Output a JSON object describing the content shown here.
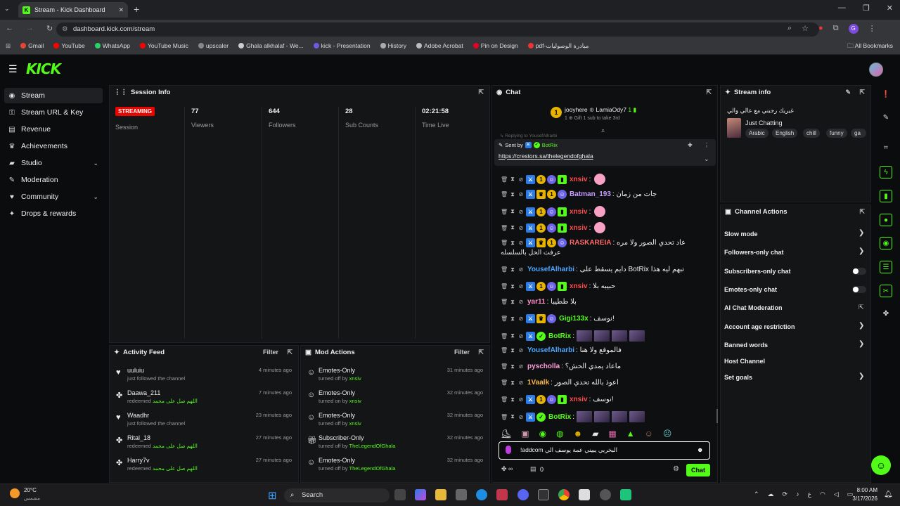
{
  "browser": {
    "tab_title": "Stream - Kick Dashboard",
    "url": "dashboard.kick.com/stream",
    "bookmarks": [
      "Gmail",
      "YouTube",
      "WhatsApp",
      "YouTube Music",
      "upscaler",
      "Ghala alkhalaf - We...",
      "kick - Presentation",
      "History",
      "Adobe Acrobat",
      "Pin on Design",
      "pdf-مبادرة الوصوليات"
    ],
    "all_bookmarks": "All Bookmarks",
    "profile_letter": "G"
  },
  "app": {
    "logo": "KICK"
  },
  "sidebar": {
    "items": [
      {
        "label": "Stream",
        "icon": "stream-icon"
      },
      {
        "label": "Stream URL & Key",
        "icon": "key-icon"
      },
      {
        "label": "Revenue",
        "icon": "revenue-icon"
      },
      {
        "label": "Achievements",
        "icon": "trophy-icon"
      },
      {
        "label": "Studio",
        "icon": "studio-icon"
      },
      {
        "label": "Moderation",
        "icon": "wrench-icon"
      },
      {
        "label": "Community",
        "icon": "community-icon"
      },
      {
        "label": "Drops & rewards",
        "icon": "gift-icon"
      }
    ]
  },
  "session": {
    "title": "Session Info",
    "badge": "STREAMING",
    "session_label": "Session",
    "viewers": "77",
    "viewers_label": "Viewers",
    "followers": "644",
    "followers_label": "Followers",
    "subs": "28",
    "subs_label": "Sub Counts",
    "time": "02:21:58",
    "time_label": "Time Live"
  },
  "activity": {
    "title": "Activity Feed",
    "filter": "Filter",
    "rows": [
      {
        "name": "uuluiu",
        "sub": "just followed the channel",
        "extra": "",
        "time": "4 minutes ago"
      },
      {
        "name": "Daawa_211",
        "sub": "redeemed",
        "extra": "اللهم صل على محمد",
        "time": "7 minutes ago"
      },
      {
        "name": "Waadhr",
        "sub": "just followed the channel",
        "extra": "",
        "time": "23 minutes ago"
      },
      {
        "name": "Rital_18",
        "sub": "redeemed",
        "extra": "اللهم صل على محمد",
        "time": "27 minutes ago"
      },
      {
        "name": "Harry7v",
        "sub": "redeemed",
        "extra": "اللهم صل على محمد",
        "time": "27 minutes ago"
      }
    ]
  },
  "mod_actions": {
    "title": "Mod Actions",
    "filter": "Filter",
    "rows": [
      {
        "name": "Emotes-Only",
        "sub": "turned off by",
        "by": "xnsiv",
        "time": "31 minutes ago"
      },
      {
        "name": "Emotes-Only",
        "sub": "turned on by",
        "by": "xnsiv",
        "time": "32 minutes ago"
      },
      {
        "name": "Emotes-Only",
        "sub": "turned off by",
        "by": "xnsiv",
        "time": "32 minutes ago"
      },
      {
        "name": "Subscriber-Only",
        "sub": "turned off by",
        "by": "TheLegendOfGhala",
        "time": "32 minutes ago"
      },
      {
        "name": "Emotes-Only",
        "sub": "turned off by",
        "by": "TheLegendOfGhala",
        "time": "32 minutes ago"
      }
    ]
  },
  "chat": {
    "title": "Chat",
    "gift_from": "jooyhere",
    "gift_to": "LamiaOdy7",
    "gift_count": "1",
    "gift_text": "Gift 1 sub to take 3rd",
    "pinned_by_label": "Sent by",
    "pinned_by": "BotRix",
    "pinned_link": "https://crestors.sa/thelegendofghala",
    "reply_hint": "Replying to YousefAlharbi",
    "messages": [
      {
        "user": "xnsiv",
        "color": "#ff4d4d",
        "text": ":",
        "badges": [
          "mod",
          "sub",
          "og",
          "gif"
        ]
      },
      {
        "user": "Batman_193",
        "color": "#c69cff",
        "text": ": جات من زمان",
        "badges": [
          "mod",
          "crown",
          "sub",
          "og"
        ]
      },
      {
        "user": "xnsiv",
        "color": "#ff4d4d",
        "text": ":",
        "badges": [
          "mod",
          "sub",
          "og",
          "gif"
        ]
      },
      {
        "user": "xnsiv",
        "color": "#ff4d4d",
        "text": ":",
        "badges": [
          "mod",
          "sub",
          "og",
          "gif"
        ]
      },
      {
        "user": "RASKAREIA",
        "color": "#ff6b6b",
        "text": ": عاد تحدي الصور ولا مره",
        "badges": [
          "mod",
          "crown",
          "sub",
          "og"
        ]
      },
      {
        "user": "YousefAlharbi",
        "color": "#4da6ff",
        "text": ": دايم يسقط على BotRix تبهم ليه هذا",
        "badges": []
      },
      {
        "user": "xnsiv",
        "color": "#ff4d4d",
        "text": ": حبيبه بلا",
        "badges": [
          "mod",
          "sub",
          "og",
          "gif"
        ]
      },
      {
        "user": "yar11",
        "color": "#ff8cc6",
        "text": ": بلا ططيبا",
        "badges": []
      },
      {
        "user": "Gigi133x",
        "color": "#53fc18",
        "text": ": نوسف!",
        "badges": [
          "mod",
          "crown",
          "og"
        ]
      },
      {
        "user": "BotRix",
        "color": "#53fc18",
        "text": ":",
        "badges": [
          "mod",
          "ver"
        ]
      },
      {
        "user": "YousefAlharbi",
        "color": "#4da6ff",
        "text": ": فالموقع ولا هنا",
        "badges": []
      },
      {
        "user": "pyscholla",
        "color": "#ff9ed8",
        "text": ": ماعاد يمدي الحش؟",
        "badges": []
      },
      {
        "user": "1Vaalk",
        "color": "#ffb84d",
        "text": ": اعوذ بالله تحدي الصور",
        "badges": []
      },
      {
        "user": "xnsiv",
        "color": "#ff4d4d",
        "text": ": نوسف!",
        "badges": [
          "mod",
          "sub",
          "og",
          "gif"
        ]
      },
      {
        "user": "BotRix",
        "color": "#53fc18",
        "text": ":",
        "badges": [
          "mod",
          "ver"
        ]
      }
    ],
    "wrap_text": "عرفت الحل بالسلسله",
    "input_value": "!addcom البخربي يبيني عمة يوسف الي",
    "counter": "0",
    "send_label": "Chat"
  },
  "stream_info": {
    "title": "Stream info",
    "stream_title": "غيريك رجبني مع عالي والي",
    "category": "Just Chatting",
    "tags": [
      "Arabic",
      "English",
      "chill",
      "funny",
      "ga"
    ]
  },
  "channel_actions": {
    "title": "Channel Actions",
    "items": [
      {
        "label": "Slow mode",
        "control": "chevron"
      },
      {
        "label": "Followers-only chat",
        "control": "chevron"
      },
      {
        "label": "Subscribers-only chat",
        "control": "toggle"
      },
      {
        "label": "Emotes-only chat",
        "control": "toggle"
      },
      {
        "label": "AI Chat Moderation",
        "control": "external"
      },
      {
        "label": "Account age restriction",
        "control": "chevron"
      },
      {
        "label": "Banned words",
        "control": "chevron"
      },
      {
        "label": "Host Channel",
        "control": "none"
      },
      {
        "label": "Set goals",
        "control": "chevron"
      }
    ]
  },
  "taskbar": {
    "weather_temp": "20°C",
    "weather_desc": "مشمس",
    "search": "Search",
    "lang": "ع",
    "time": "8:00 AM",
    "date": "3/17/2026"
  },
  "colors": {
    "brand": "#53fc18",
    "live": "#eb0400",
    "panel": "#141516"
  }
}
